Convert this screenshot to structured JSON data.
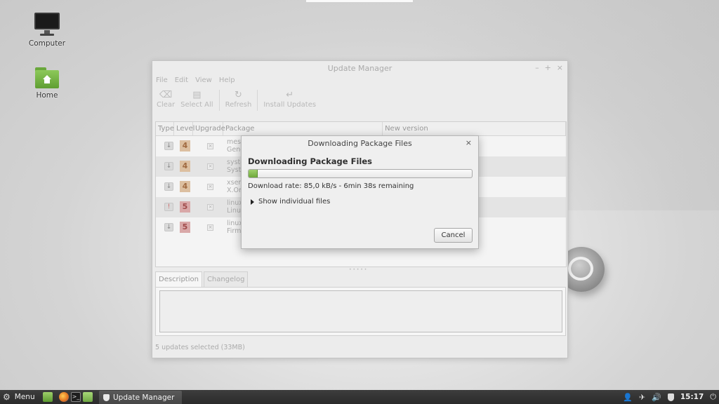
{
  "desktop": {
    "icons": [
      {
        "label": "Computer"
      },
      {
        "label": "Home"
      }
    ]
  },
  "window": {
    "title": "Update Manager",
    "controls": {
      "minimize": "–",
      "maximize": "+",
      "close": "×"
    },
    "menu": [
      "File",
      "Edit",
      "View",
      "Help"
    ],
    "toolbar": [
      {
        "label": "Clear",
        "icon": "clear-icon"
      },
      {
        "label": "Select All",
        "icon": "select-all-icon"
      },
      {
        "label": "Refresh",
        "icon": "refresh-icon"
      },
      {
        "label": "Install Updates",
        "icon": "install-icon"
      }
    ],
    "table": {
      "columns": [
        "Type",
        "Level",
        "Upgrade",
        "Package",
        "New version"
      ],
      "rows": [
        {
          "type": "↓",
          "level": "4",
          "package_line1": "mesa",
          "package_line2": "Gener"
        },
        {
          "type": "↓",
          "level": "4",
          "package_line1": "syste",
          "package_line2": "Syste"
        },
        {
          "type": "↓",
          "level": "4",
          "package_line1": "xserve",
          "package_line2": "X.Org"
        },
        {
          "type": "!",
          "level": "5",
          "package_line1": "linux-",
          "package_line2": "Linux"
        },
        {
          "type": "↓",
          "level": "5",
          "package_line1": "linux-",
          "package_line2": "Firmw"
        }
      ]
    },
    "tabs": [
      "Description",
      "Changelog"
    ],
    "status": "5 updates selected (33MB)"
  },
  "dialog": {
    "title": "Downloading Package Files",
    "close": "×",
    "heading": "Downloading Package Files",
    "progress_fraction": 0.04,
    "rate_text": "Download rate: 85,0 kB/s - 6min 38s remaining",
    "expander_label": "Show individual files",
    "cancel_label": "Cancel"
  },
  "taskbar": {
    "menu_label": "Menu",
    "task_label": "Update Manager",
    "clock": "15:17",
    "colors": {
      "bar": "#333333",
      "progress": "#7fb84b"
    }
  }
}
